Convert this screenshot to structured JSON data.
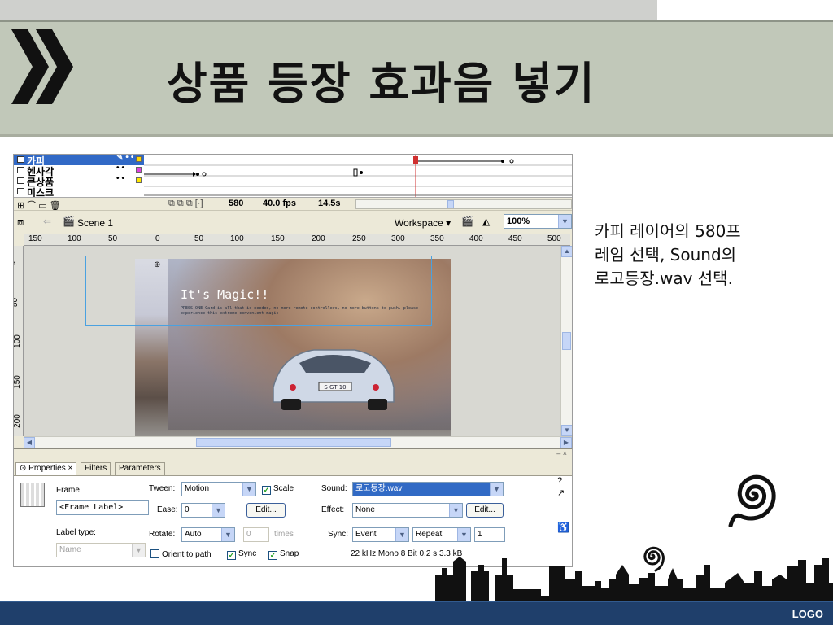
{
  "slide": {
    "title": "상품 등장 효과음 넣기",
    "description": [
      "카피 레이어의 580프",
      "레임 선택, Sound의",
      "로고등장.wav 선택."
    ],
    "logo": "LOGO"
  },
  "timeline": {
    "layers": [
      "카피",
      "헨사각",
      "큰상품",
      "미스크"
    ],
    "frame_number": "580",
    "fps": "40.0 fps",
    "time": "14.5s"
  },
  "editbar": {
    "scene": "Scene 1",
    "workspace": "Workspace ▾",
    "zoom": "100%"
  },
  "ruler": {
    "top": [
      "150",
      "100",
      "50",
      "0",
      "50",
      "100",
      "150",
      "200",
      "250",
      "300",
      "350",
      "400",
      "450",
      "500"
    ],
    "left": [
      "0",
      "50",
      "100",
      "150",
      "200"
    ]
  },
  "stage": {
    "headline": "It's Magic!!",
    "subtext": "PRESS ONE Card is all that is needed, no more remote controllers, no more buttons to push. please experience this extreme convenient magic",
    "plate": "S·GT 10"
  },
  "panel": {
    "tabs": [
      "⊙ Properties ×",
      "Filters",
      "Parameters"
    ],
    "frame_label": "Frame",
    "frame_placeholder": "<Frame Label>",
    "label_type_label": "Label type:",
    "label_type_value": "Name",
    "tween_label": "Tween:",
    "tween_value": "Motion",
    "scale_label": "Scale",
    "ease_label": "Ease:",
    "ease_value": "0",
    "edit_label": "Edit...",
    "rotate_label": "Rotate:",
    "rotate_value": "Auto",
    "rotate_times": "0",
    "times_label": "times",
    "orient_label": "Orient to path",
    "sync_check_label": "Sync",
    "snap_label": "Snap",
    "sound_label": "Sound:",
    "sound_value": "로고등장.wav",
    "effect_label": "Effect:",
    "effect_value": "None",
    "effect_edit": "Edit...",
    "sync_label": "Sync:",
    "sync_value": "Event",
    "repeat_value": "Repeat",
    "repeat_count": "1",
    "sound_info": "22 kHz Mono 8 Bit 0.2 s 3.3 kB"
  }
}
